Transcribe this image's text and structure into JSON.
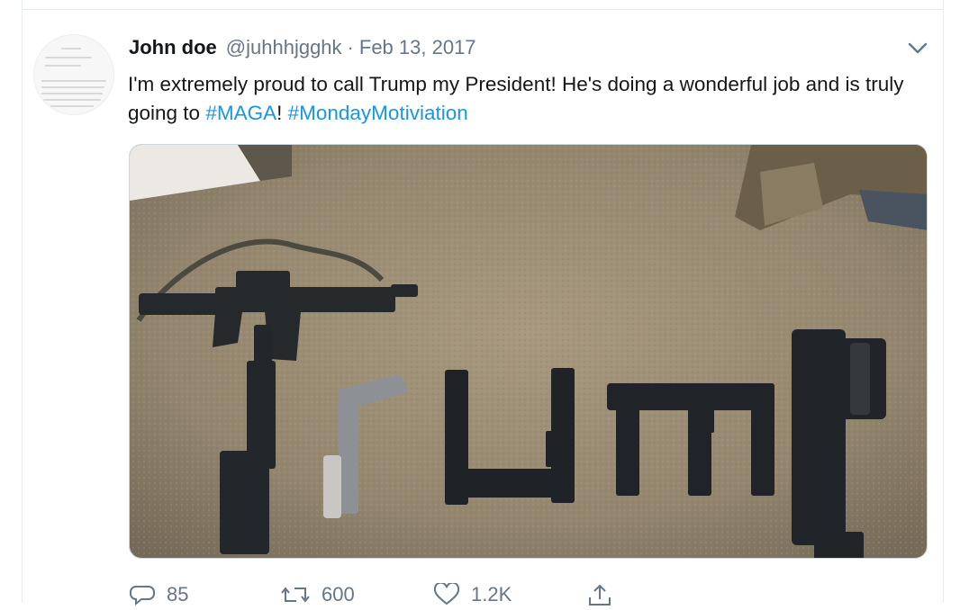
{
  "tweet": {
    "author_name": "John doe",
    "author_handle": "@juhhhjgghk",
    "separator": "·",
    "date": "Feb 13, 2017",
    "text_before": "I'm extremely proud to call Trump my President! He's doing a wonderful job and is truly going to ",
    "hashtag_1": "#MAGA",
    "text_middle": "! ",
    "hashtag_2": "#MondayMotiviation",
    "media_icon": "photo-of-guns-spelling-trump",
    "menu_icon": "chevron-down-icon"
  },
  "actions": {
    "reply_count": "85",
    "retweet_count": "600",
    "like_count": "1.2K",
    "reply_icon": "reply-icon",
    "retweet_icon": "retweet-icon",
    "like_icon": "heart-icon",
    "share_icon": "share-icon"
  },
  "colors": {
    "text": "#14171a",
    "secondary": "#657786",
    "link": "#1b95e0",
    "border": "#e6ecf0"
  }
}
